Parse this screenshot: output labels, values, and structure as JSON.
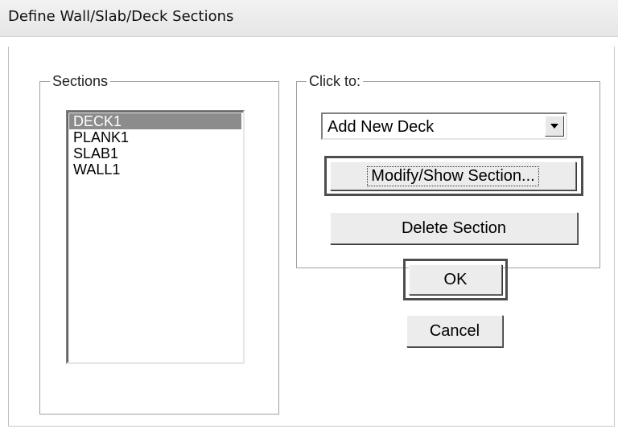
{
  "window": {
    "title": "Define Wall/Slab/Deck Sections"
  },
  "sections": {
    "label": "Sections",
    "items": [
      {
        "label": "DECK1",
        "selected": true
      },
      {
        "label": "PLANK1",
        "selected": false
      },
      {
        "label": "SLAB1",
        "selected": false
      },
      {
        "label": "WALL1",
        "selected": false
      }
    ]
  },
  "click_to": {
    "label": "Click to:",
    "combo_value": "Add New Deck",
    "combo_arrow_icon": "chevron-down-icon",
    "modify_label": "Modify/Show Section...",
    "delete_label": "Delete Section"
  },
  "buttons": {
    "ok_label": "OK",
    "cancel_label": "Cancel"
  },
  "colors": {
    "selected_item_bg": "#8c8c8c",
    "button_face": "#ececec",
    "highlight_border": "#4d4d4d"
  }
}
